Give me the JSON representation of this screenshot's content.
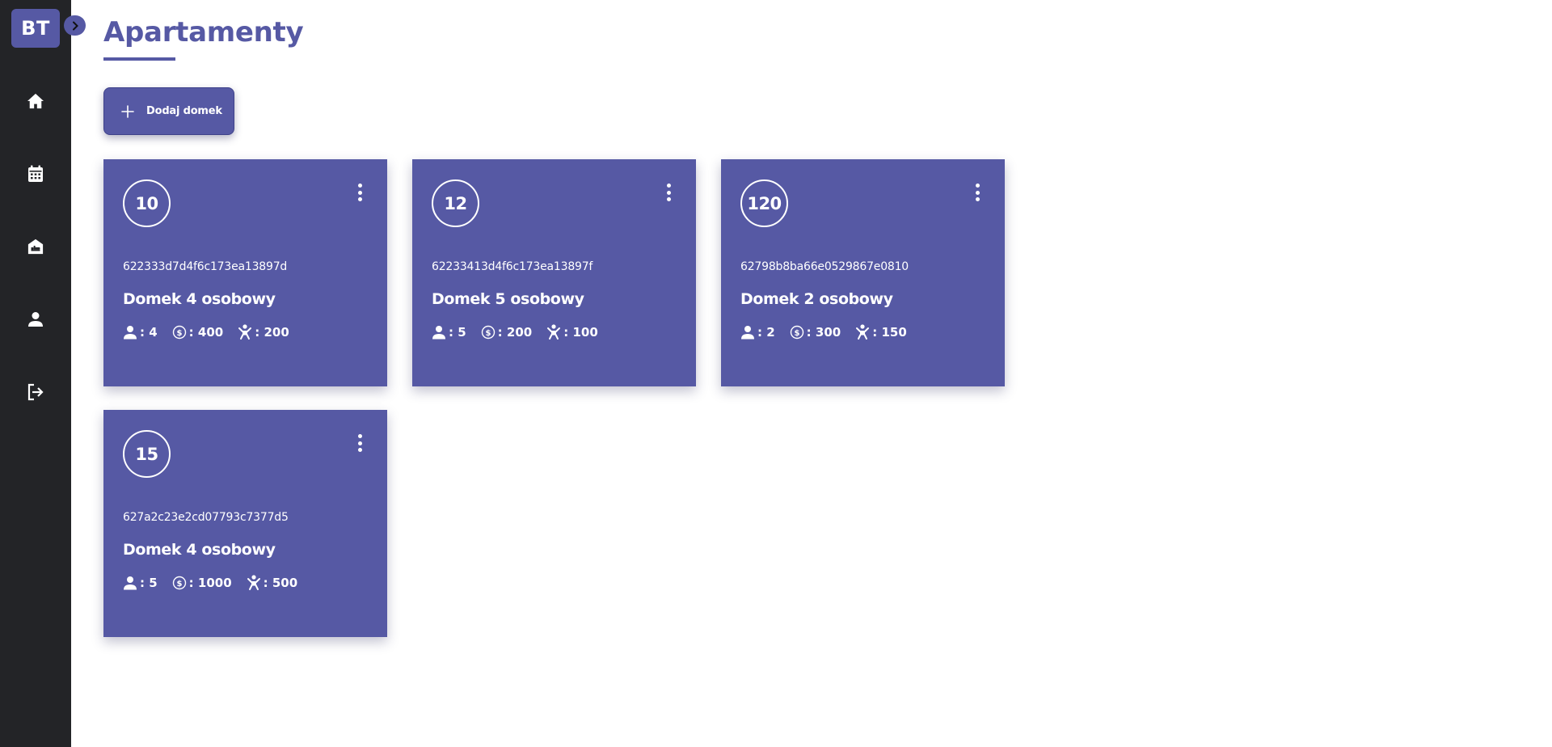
{
  "sidebar": {
    "logo": "BT",
    "items": [
      {
        "icon": "home-icon"
      },
      {
        "icon": "calendar-icon"
      },
      {
        "icon": "house-bed-icon"
      },
      {
        "icon": "user-icon"
      },
      {
        "icon": "logout-icon"
      }
    ]
  },
  "header": {
    "title": "Apartamenty"
  },
  "toolbar": {
    "add_label": "Dodaj domek"
  },
  "cards": [
    {
      "number": "10",
      "id": "622333d7d4f6c173ea13897d",
      "name": "Domek 4 osobowy",
      "persons": ": 4",
      "price": ": 400",
      "child_price": ": 200"
    },
    {
      "number": "12",
      "id": "62233413d4f6c173ea13897f",
      "name": "Domek 5 osobowy",
      "persons": ": 5",
      "price": ": 200",
      "child_price": ": 100"
    },
    {
      "number": "120",
      "id": "62798b8ba66e0529867e0810",
      "name": "Domek 2 osobowy",
      "persons": ": 2",
      "price": ": 300",
      "child_price": ": 150"
    },
    {
      "number": "15",
      "id": "627a2c23e2cd07793c7377d5",
      "name": "Domek 4 osobowy",
      "persons": ": 5",
      "price": ": 1000",
      "child_price": ": 500"
    }
  ],
  "colors": {
    "accent": "#5659a4",
    "sidebar": "#232427",
    "background": "#ffffff"
  }
}
